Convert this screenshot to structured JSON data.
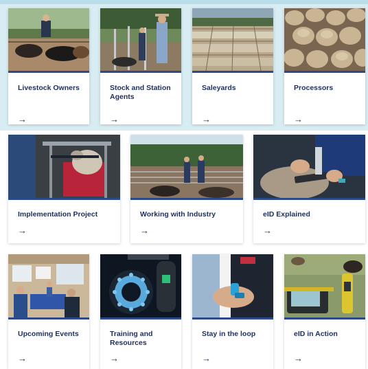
{
  "cards": [
    {
      "title": "Livestock Owners",
      "arrow": "→",
      "image": "farmer-with-cattle-photo"
    },
    {
      "title": "Stock and Station Agents",
      "arrow": "→",
      "image": "agents-at-yards-photo"
    },
    {
      "title": "Saleyards",
      "arrow": "→",
      "image": "sheep-pens-photo"
    },
    {
      "title": "Processors",
      "arrow": "→",
      "image": "sheep-flock-photo"
    },
    {
      "title": "Implementation Project",
      "arrow": "→",
      "image": "sheep-handler-photo"
    },
    {
      "title": "Working with Industry",
      "arrow": "→",
      "image": "people-at-saleyard-photo"
    },
    {
      "title": "eID Explained",
      "arrow": "→",
      "image": "tag-scanning-photo"
    },
    {
      "title": "Upcoming Events",
      "arrow": "→",
      "image": "workshop-room-photo"
    },
    {
      "title": "Training and Resources",
      "arrow": "→",
      "image": "eid-reader-panel-photo"
    },
    {
      "title": "Stay in the loop",
      "arrow": "→",
      "image": "hand-holding-tag-photo"
    },
    {
      "title": "eID in Action",
      "arrow": "→",
      "image": "handheld-reader-paddock-photo"
    }
  ],
  "colors": {
    "title_text": "#1e2f5a",
    "accent_border": "#2b4a8a",
    "top_band": "#d7ecf3"
  }
}
